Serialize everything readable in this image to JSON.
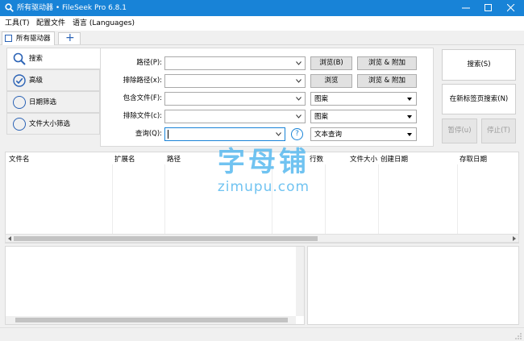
{
  "window": {
    "title": "所有驱动器 • FileSeek Pro 6.8.1"
  },
  "menu": {
    "items": [
      "工具(T)",
      "配置文件",
      "语言 (Languages)"
    ]
  },
  "tabs": {
    "items": [
      "所有驱动器"
    ],
    "add_symbol": "+"
  },
  "nav": {
    "items": [
      {
        "label": "搜索",
        "icon": "magnifier-icon"
      },
      {
        "label": "高级",
        "icon": "checkmark-circle-icon"
      },
      {
        "label": "日期筛选",
        "icon": "circle-icon"
      },
      {
        "label": "文件大小筛选",
        "icon": "circle-icon"
      }
    ]
  },
  "form": {
    "path_label": "路径(P):",
    "exclude_path_label": "排除路径(x):",
    "include_files_label": "包含文件(F):",
    "exclude_files_label": "排除文件(c):",
    "query_label": "查询(Q):",
    "path_value": "",
    "exclude_path_value": "",
    "include_files_value": "",
    "exclude_files_value": "",
    "query_value": "",
    "include_files_mode": "图案",
    "exclude_files_mode": "图案",
    "query_mode": "文本查询",
    "browse1": "浏览(B)",
    "browse_add1": "浏览 & 附加",
    "browse2": "浏览",
    "browse_add2": "浏览 & 附加",
    "help": "?"
  },
  "actions": {
    "search": "搜索(S)",
    "search_new_tab": "在新标签页搜索(N)",
    "pause": "暂停(u)",
    "stop": "停止(T)"
  },
  "results": {
    "columns": [
      "文件名",
      "扩展名",
      "路径",
      "行数",
      "文件大小",
      "创建日期",
      "存取日期"
    ]
  },
  "watermark": {
    "line1": "字母铺",
    "line2": "zimupu.com"
  }
}
